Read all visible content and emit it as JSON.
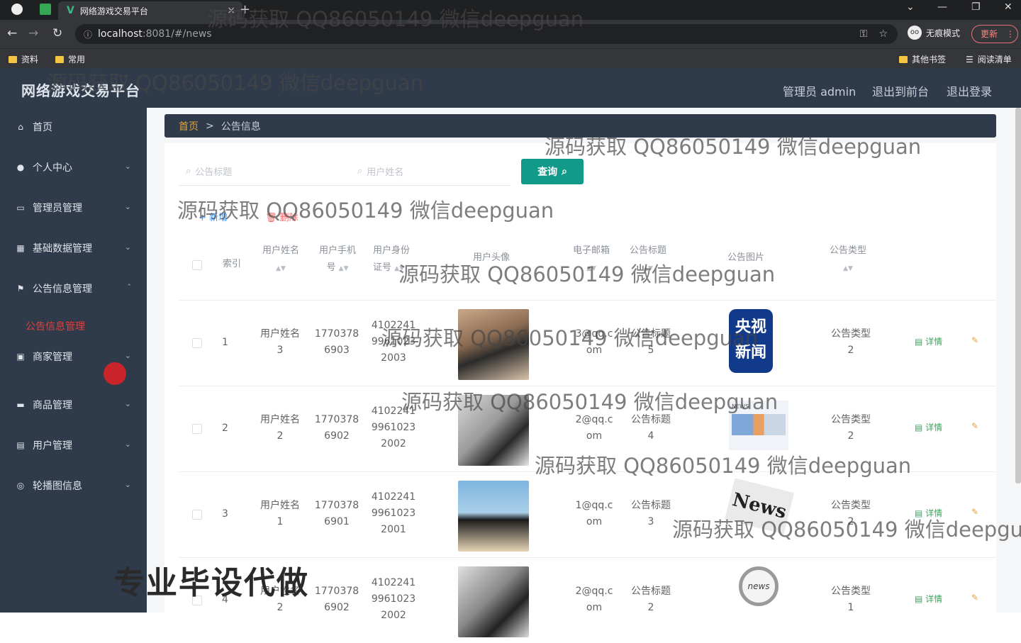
{
  "browser": {
    "tab_title": "网络游戏交易平台",
    "tab_logo": "V",
    "url_host": "localhost",
    "url_rest": ":8081/#/news",
    "incognito_label": "无痕模式",
    "update_label": "更新",
    "bookmarks": [
      "资料",
      "常用"
    ],
    "bookmarks_right": [
      "其他书签",
      "阅读清单"
    ]
  },
  "header": {
    "brand": "网络游戏交易平台",
    "admin": "管理员 admin",
    "to_front": "退出到前台",
    "logout": "退出登录"
  },
  "sidebar": {
    "items": [
      {
        "label": "首页",
        "icon": "home-icon"
      },
      {
        "label": "个人中心",
        "icon": "user-icon"
      },
      {
        "label": "管理员管理",
        "icon": "admin-icon"
      },
      {
        "label": "基础数据管理",
        "icon": "data-icon"
      },
      {
        "label": "公告信息管理",
        "icon": "flag-icon"
      },
      {
        "label": "商家管理",
        "icon": "shop-icon"
      },
      {
        "label": "商品管理",
        "icon": "goods-icon"
      },
      {
        "label": "用户管理",
        "icon": "users-icon"
      },
      {
        "label": "轮播图信息",
        "icon": "carousel-icon"
      }
    ],
    "active_sub": "公告信息管理"
  },
  "breadcrumb": {
    "home": "首页",
    "sep": ">",
    "current": "公告信息"
  },
  "search": {
    "title_placeholder": "公告标题",
    "user_placeholder": "用户姓名",
    "query_label": "查询"
  },
  "actions": {
    "add": "新增",
    "delete": "删除"
  },
  "table": {
    "headers": [
      "索引",
      "用户姓名",
      "用户手机号",
      "用户身份证号",
      "用户头像",
      "电子邮箱",
      "公告标题",
      "公告图片",
      "公告类型"
    ],
    "rows": [
      {
        "index": "1",
        "name": [
          "用户姓名",
          "3"
        ],
        "phone": [
          "1770378",
          "6903"
        ],
        "idcard": [
          "4102241",
          "9961023",
          "2003"
        ],
        "email": [
          "3@qq.c",
          "om"
        ],
        "title": [
          "公告标题",
          "5"
        ],
        "type": [
          "公告类型",
          "2"
        ]
      },
      {
        "index": "2",
        "name": [
          "用户姓名",
          "2"
        ],
        "phone": [
          "1770378",
          "6902"
        ],
        "idcard": [
          "4102241",
          "9961023",
          "2002"
        ],
        "email": [
          "2@qq.c",
          "om"
        ],
        "title": [
          "公告标题",
          "4"
        ],
        "type": [
          "公告类型",
          "2"
        ]
      },
      {
        "index": "3",
        "name": [
          "用户姓名",
          "1"
        ],
        "phone": [
          "1770378",
          "6901"
        ],
        "idcard": [
          "4102241",
          "9961023",
          "2001"
        ],
        "email": [
          "1@qq.c",
          "om"
        ],
        "title": [
          "公告标题",
          "3"
        ],
        "type": [
          "公告类型",
          "2"
        ]
      },
      {
        "index": "4",
        "name": [
          "用户姓名",
          "2"
        ],
        "phone": [
          "1770378",
          "6902"
        ],
        "idcard": [
          "4102241",
          "9961023",
          "2002"
        ],
        "email": [
          "2@qq.c",
          "om"
        ],
        "title": [
          "公告标题",
          "2"
        ],
        "type": [
          "公告类型",
          "1"
        ]
      }
    ],
    "detail_label": "详情"
  },
  "image_labels": {
    "cctv_line1": "央视",
    "cctv_line2": "新闻",
    "news": "News",
    "news_small": "news",
    "news_board": "NEWS"
  },
  "watermark": "源码获取 QQ86050149 微信deepguan",
  "overlay_text": "专业毕设代做"
}
